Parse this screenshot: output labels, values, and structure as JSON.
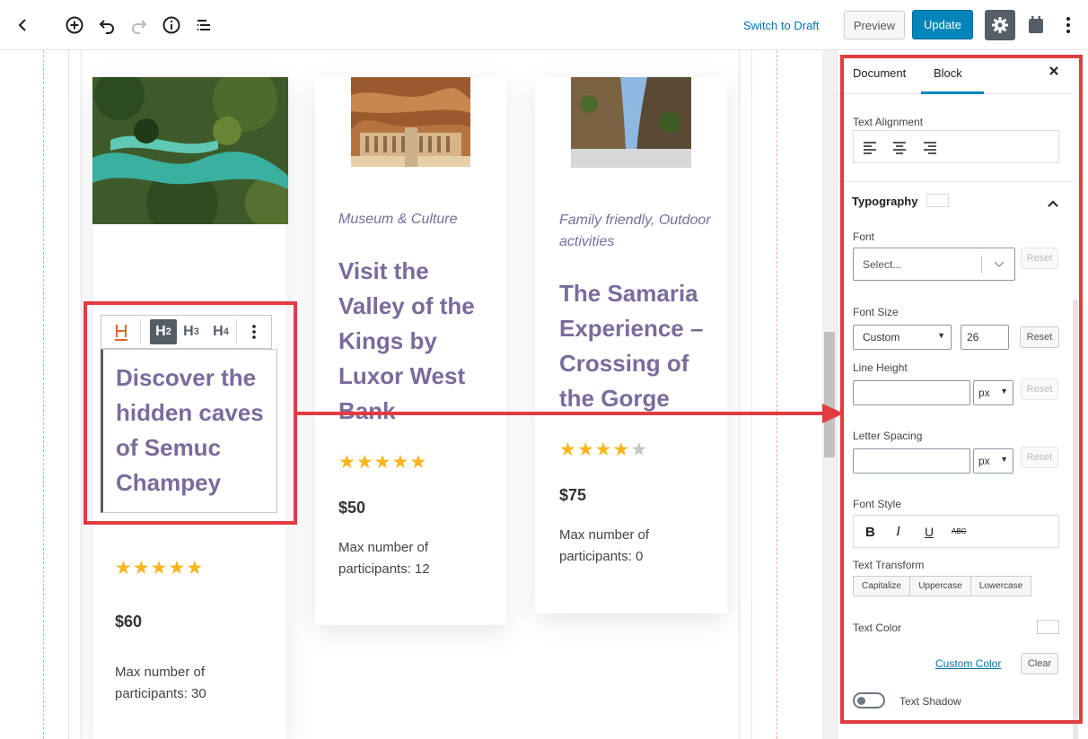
{
  "topbar": {
    "back_icon": "chevron-left-icon",
    "add_icon": "plus-circle-icon",
    "undo_icon": "undo-icon",
    "redo_icon": "redo-icon",
    "info_icon": "info-icon",
    "outline_icon": "list-outline-icon",
    "switch_to_draft": "Switch to Draft",
    "preview": "Preview",
    "update": "Update",
    "settings_icon": "gear-icon",
    "plugin_icon": "calendar-icon",
    "more_icon": "more-vertical-icon"
  },
  "cards": [
    {
      "category": "",
      "title": "Discover the hidden caves of Semuc Champey",
      "rating": 5,
      "price": "$60",
      "max_participants": "Max number of participants: 30"
    },
    {
      "category": "Museum & Culture",
      "title": "Visit the Valley of the Kings by Luxor West Bank",
      "rating": 5,
      "price": "$50",
      "max_participants": "Max number of participants: 12"
    },
    {
      "category": "Family friendly, Outdoor activities",
      "title": "The Samaria Experience – Crossing of the Gorge",
      "rating": 4,
      "price": "$75",
      "max_participants": "Max number of participants: 0"
    }
  ],
  "heading_toolbar": {
    "block_icon": "heading-icon",
    "h2": "H2",
    "h3": "H3",
    "h4": "H4",
    "more_icon": "more-vertical-icon",
    "active": "H2"
  },
  "sidebar": {
    "tabs": [
      "Document",
      "Block"
    ],
    "active_tab": "Block",
    "close_icon": "close-icon",
    "text_alignment": {
      "label": "Text Alignment",
      "icons": [
        "align-left-icon",
        "align-center-icon",
        "align-right-icon"
      ]
    },
    "typography": {
      "label": "Typography",
      "toggle_icon": "chevron-up-icon"
    },
    "font": {
      "label": "Font",
      "placeholder": "Select...",
      "reset": "Reset"
    },
    "font_size": {
      "label": "Font Size",
      "unit_value": "Custom",
      "value": "26",
      "reset": "Reset"
    },
    "line_height": {
      "label": "Line Height",
      "unit": "px",
      "reset": "Reset"
    },
    "letter_spacing": {
      "label": "Letter Spacing",
      "unit": "px",
      "reset": "Reset"
    },
    "font_style": {
      "label": "Font Style",
      "buttons": [
        "B",
        "I",
        "U",
        "ABC"
      ]
    },
    "text_transform": {
      "label": "Text Transform",
      "options": [
        "Capitalize",
        "Uppercase",
        "Lowercase"
      ]
    },
    "text_color": {
      "label": "Text Color",
      "custom_color": "Custom Color",
      "clear": "Clear"
    },
    "text_shadow": {
      "label": "Text Shadow",
      "enabled": false
    }
  },
  "colors": {
    "accent": "#0085ba",
    "heading": "#7b6b9c",
    "star": "#f7b61c",
    "annotation": "#e23b40"
  }
}
